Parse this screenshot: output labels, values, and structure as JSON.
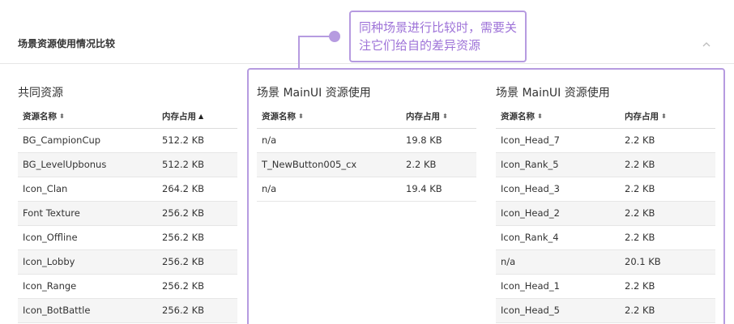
{
  "section": {
    "title": "场景资源使用情况比较"
  },
  "annotation": {
    "text": "同种场景进行比较时，需要关注它们给自的差异资源"
  },
  "shared": {
    "title": "共同资源",
    "headers": {
      "name": "资源名称",
      "usage": "内存占用"
    },
    "rows": [
      {
        "name": "BG_CampionCup",
        "usage": "512.2 KB"
      },
      {
        "name": "BG_LevelUpbonus",
        "usage": "512.2 KB"
      },
      {
        "name": "Icon_Clan",
        "usage": "264.2 KB"
      },
      {
        "name": "Font Texture",
        "usage": "256.2 KB"
      },
      {
        "name": "Icon_Offline",
        "usage": "256.2 KB"
      },
      {
        "name": "Icon_Lobby",
        "usage": "256.2 KB"
      },
      {
        "name": "Icon_Range",
        "usage": "256.2 KB"
      },
      {
        "name": "Icon_BotBattle",
        "usage": "256.2 KB"
      }
    ]
  },
  "sceneA": {
    "title": "场景 MainUI 资源使用",
    "headers": {
      "name": "资源名称",
      "usage": "内存占用"
    },
    "rows": [
      {
        "name": "n/a",
        "usage": "19.8 KB"
      },
      {
        "name": "T_NewButton005_cx",
        "usage": "2.2 KB"
      },
      {
        "name": "n/a",
        "usage": "19.4 KB"
      }
    ]
  },
  "sceneB": {
    "title": "场景 MainUI 资源使用",
    "headers": {
      "name": "资源名称",
      "usage": "内存占用"
    },
    "rows": [
      {
        "name": "Icon_Head_7",
        "usage": "2.2 KB"
      },
      {
        "name": "Icon_Rank_5",
        "usage": "2.2 KB"
      },
      {
        "name": "Icon_Head_3",
        "usage": "2.2 KB"
      },
      {
        "name": "Icon_Head_2",
        "usage": "2.2 KB"
      },
      {
        "name": "Icon_Rank_4",
        "usage": "2.2 KB"
      },
      {
        "name": "n/a",
        "usage": "20.1 KB"
      },
      {
        "name": "Icon_Head_1",
        "usage": "2.2 KB"
      },
      {
        "name": "Icon_Head_5",
        "usage": "2.2 KB"
      }
    ]
  },
  "colors": {
    "accent": "#b69be0",
    "annotation_text": "#9e73d8",
    "stripe": "#f5f5f5"
  },
  "icons": {
    "collapse": "chevron-up-icon",
    "sort": "sort-icon",
    "sort_asc": "sort-ascending-icon"
  }
}
